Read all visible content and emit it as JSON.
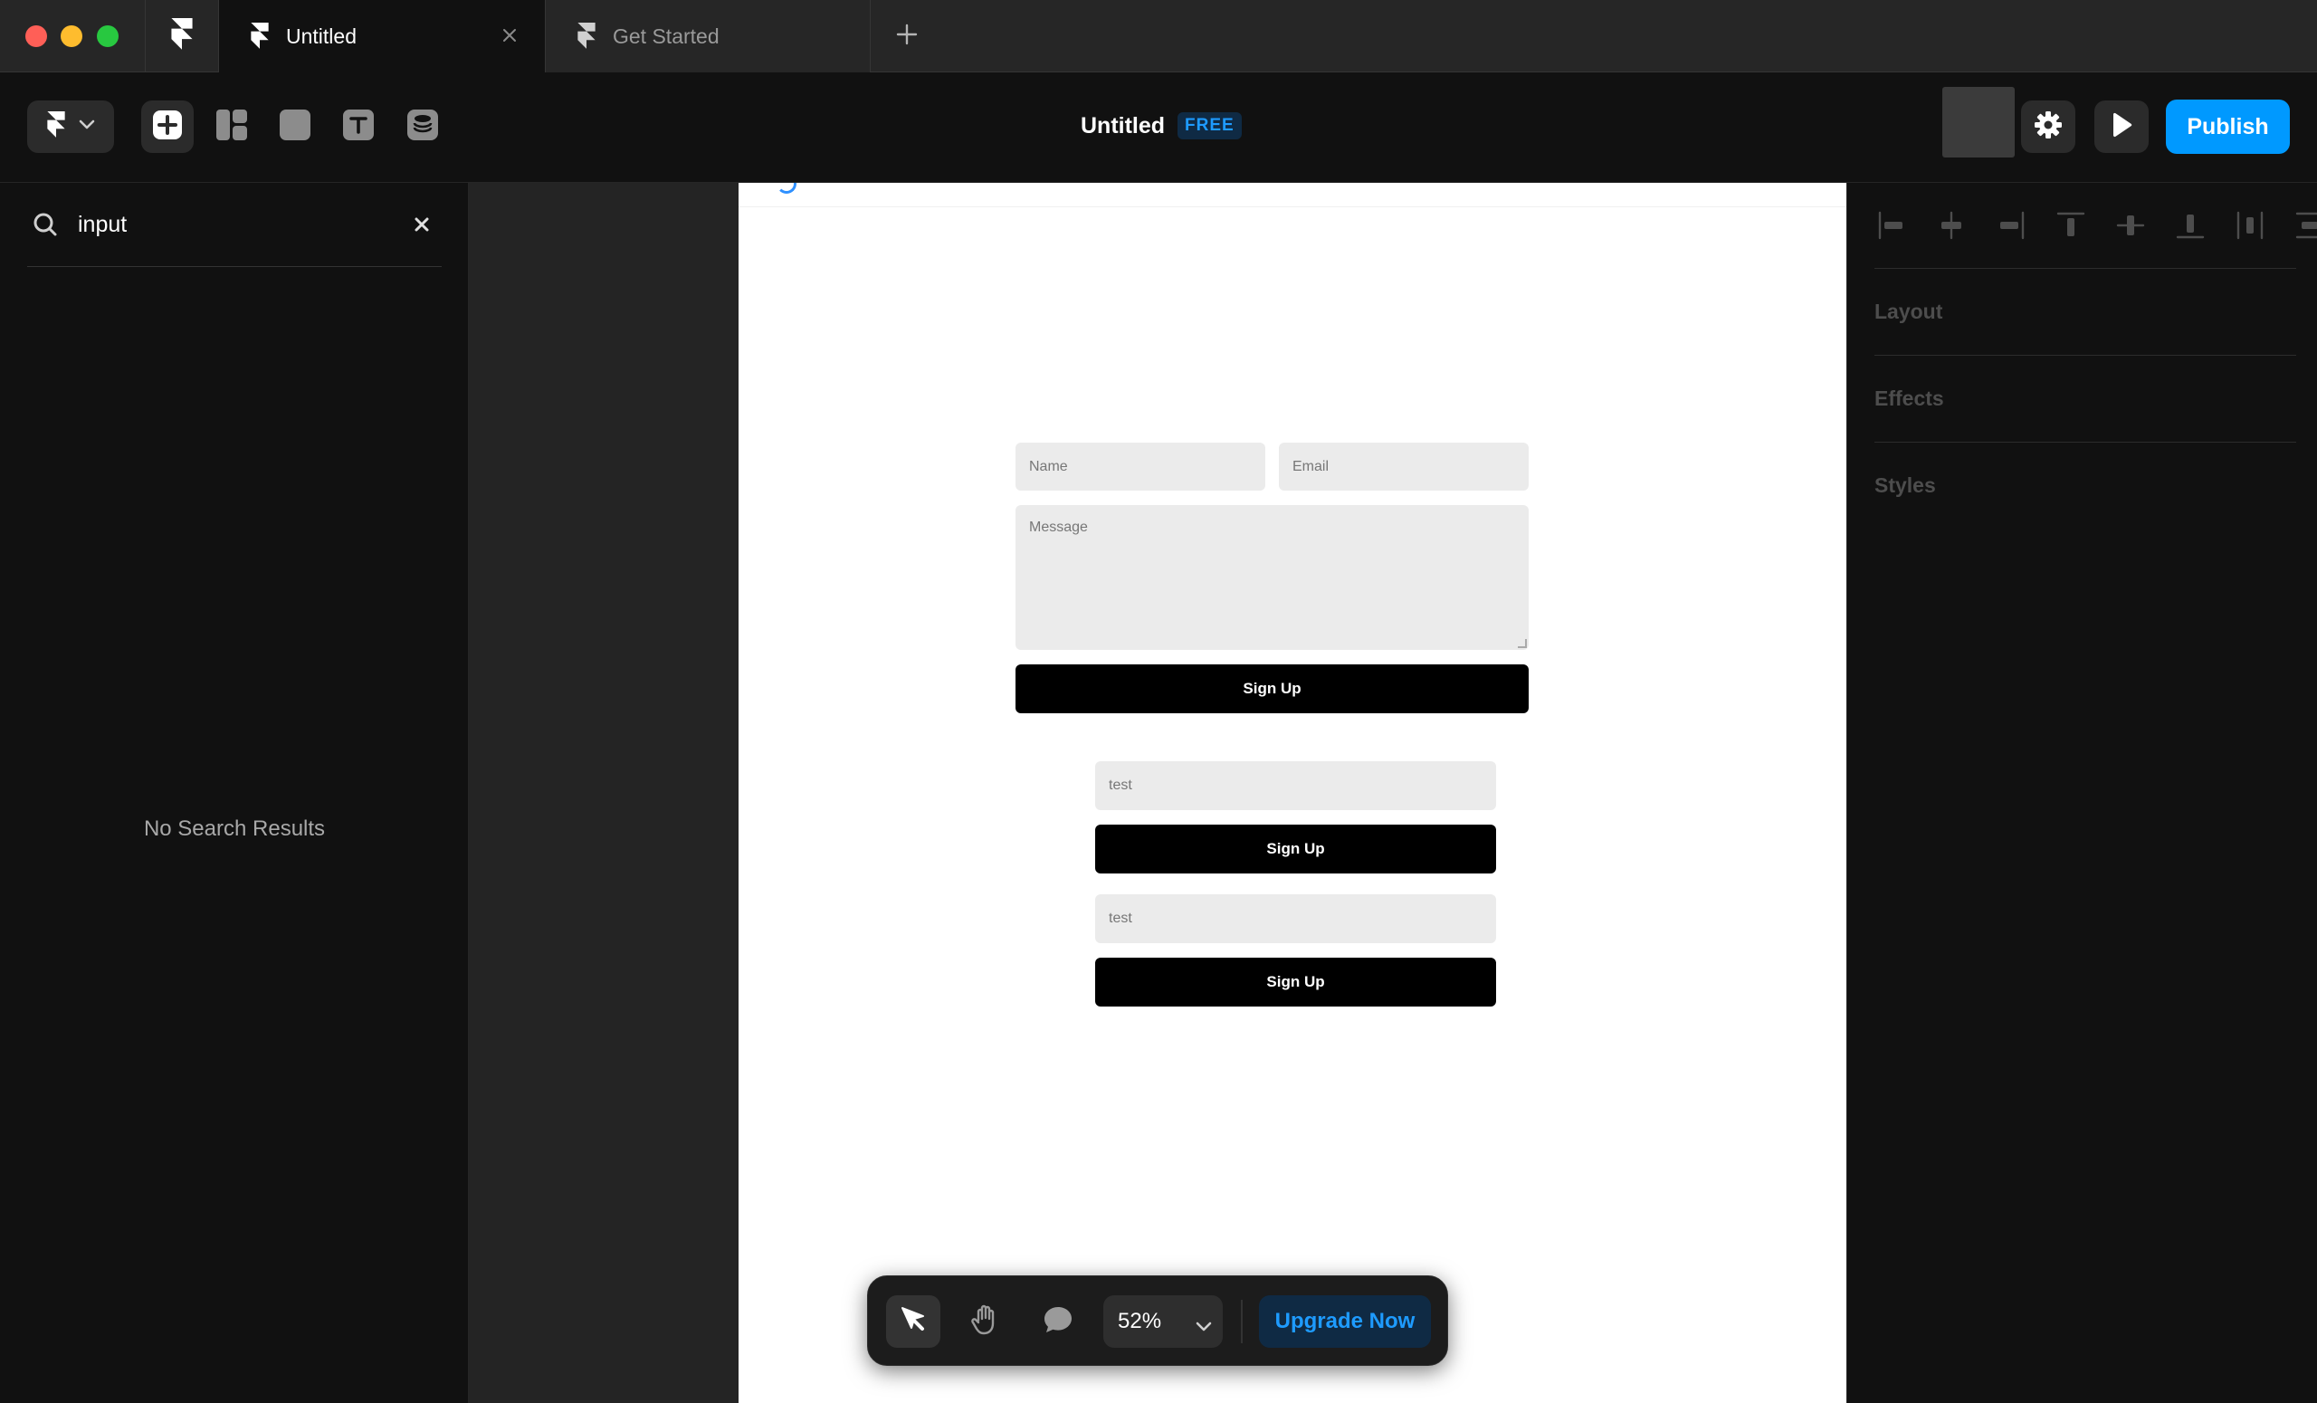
{
  "window": {
    "tabs": [
      {
        "label": "Untitled",
        "active": true
      },
      {
        "label": "Get Started",
        "active": false
      }
    ]
  },
  "toolbar": {
    "doc_title": "Untitled",
    "plan_badge": "FREE",
    "publish_label": "Publish"
  },
  "left_panel": {
    "search_value": "input",
    "empty_message": "No Search Results"
  },
  "canvas_page": {
    "form1": {
      "name_placeholder": "Name",
      "email_placeholder": "Email",
      "message_placeholder": "Message",
      "button_label": "Sign Up"
    },
    "form2": {
      "input_placeholder": "test",
      "button_label": "Sign Up"
    },
    "form3": {
      "input_placeholder": "test",
      "button_label": "Sign Up"
    }
  },
  "bottom_bar": {
    "zoom_level": "52%",
    "upgrade_label": "Upgrade Now"
  },
  "right_panel": {
    "sections": [
      "Layout",
      "Effects",
      "Styles"
    ]
  },
  "colors": {
    "accent": "#0099ff",
    "badge_text": "#1e9bff",
    "badge_bg": "#0f2a44",
    "traffic_red": "#ff5f57",
    "traffic_yellow": "#febc2e",
    "traffic_green": "#28c840"
  }
}
